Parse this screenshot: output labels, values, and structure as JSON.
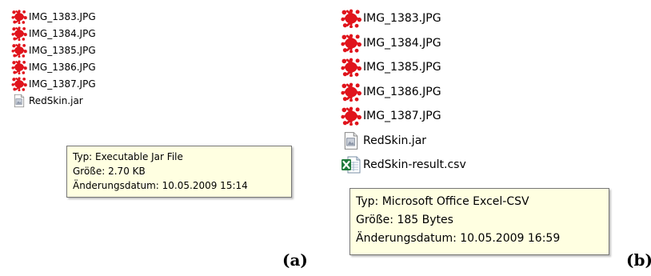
{
  "colors": {
    "tooltip_bg": "#ffffe1",
    "tooltip_border": "#767676",
    "image_icon_red": "#e0141c",
    "excel_icon_green": "#1f7a3c"
  },
  "panel_a": {
    "label": "(a)",
    "files": [
      {
        "name": "IMG_1383.JPG",
        "icon": "red-image-icon"
      },
      {
        "name": "IMG_1384.JPG",
        "icon": "red-image-icon"
      },
      {
        "name": "IMG_1385.JPG",
        "icon": "red-image-icon"
      },
      {
        "name": "IMG_1386.JPG",
        "icon": "red-image-icon"
      },
      {
        "name": "IMG_1387.JPG",
        "icon": "red-image-icon"
      },
      {
        "name": "RedSkin.jar",
        "icon": "jar-file-icon"
      }
    ],
    "tooltip": {
      "type": "Typ: Executable Jar File",
      "size": "Größe: 2.70 KB",
      "modified": "Änderungsdatum: 10.05.2009 15:14"
    }
  },
  "panel_b": {
    "label": "(b)",
    "files": [
      {
        "name": "IMG_1383.JPG",
        "icon": "red-image-icon"
      },
      {
        "name": "IMG_1384.JPG",
        "icon": "red-image-icon"
      },
      {
        "name": "IMG_1385.JPG",
        "icon": "red-image-icon"
      },
      {
        "name": "IMG_1386.JPG",
        "icon": "red-image-icon"
      },
      {
        "name": "IMG_1387.JPG",
        "icon": "red-image-icon"
      },
      {
        "name": "RedSkin.jar",
        "icon": "jar-file-icon"
      },
      {
        "name": "RedSkin-result.csv",
        "icon": "excel-csv-icon"
      }
    ],
    "tooltip": {
      "type": "Typ: Microsoft Office Excel-CSV",
      "size": "Größe: 185 Bytes",
      "modified": "Änderungsdatum: 10.05.2009 16:59"
    }
  }
}
